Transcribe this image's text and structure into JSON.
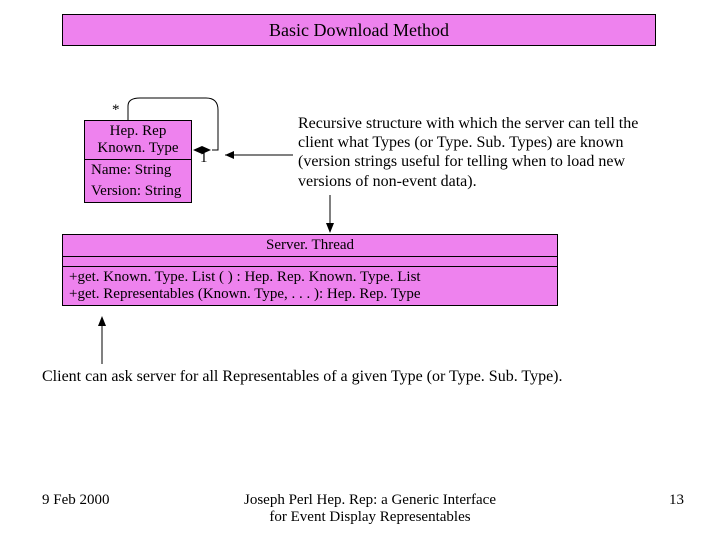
{
  "title": "Basic Download Method",
  "umlHep": {
    "name": "Hep. Rep Known. Type",
    "attr1": "Name: String",
    "attr2": "Version: String"
  },
  "umlServer": {
    "name": "Server. Thread",
    "op1": "+get. Known. Type. List ( ) : Hep. Rep. Known. Type. List",
    "op2": "+get. Representables (Known. Type, . . . ): Hep. Rep. Type"
  },
  "labels": {
    "star": "*",
    "one": "1"
  },
  "desc": "Recursive structure with which the server can tell the client what Types (or Type. Sub. Types) are known (version strings useful for telling when to load new versions of non-event data).",
  "client_line": "Client can ask server for all Representables of a given Type (or Type. Sub. Type).",
  "footer": {
    "date": "9 Feb 2000",
    "center": "Joseph Perl   Hep. Rep: a Generic Interface for Event Display Representables",
    "page": "13"
  }
}
